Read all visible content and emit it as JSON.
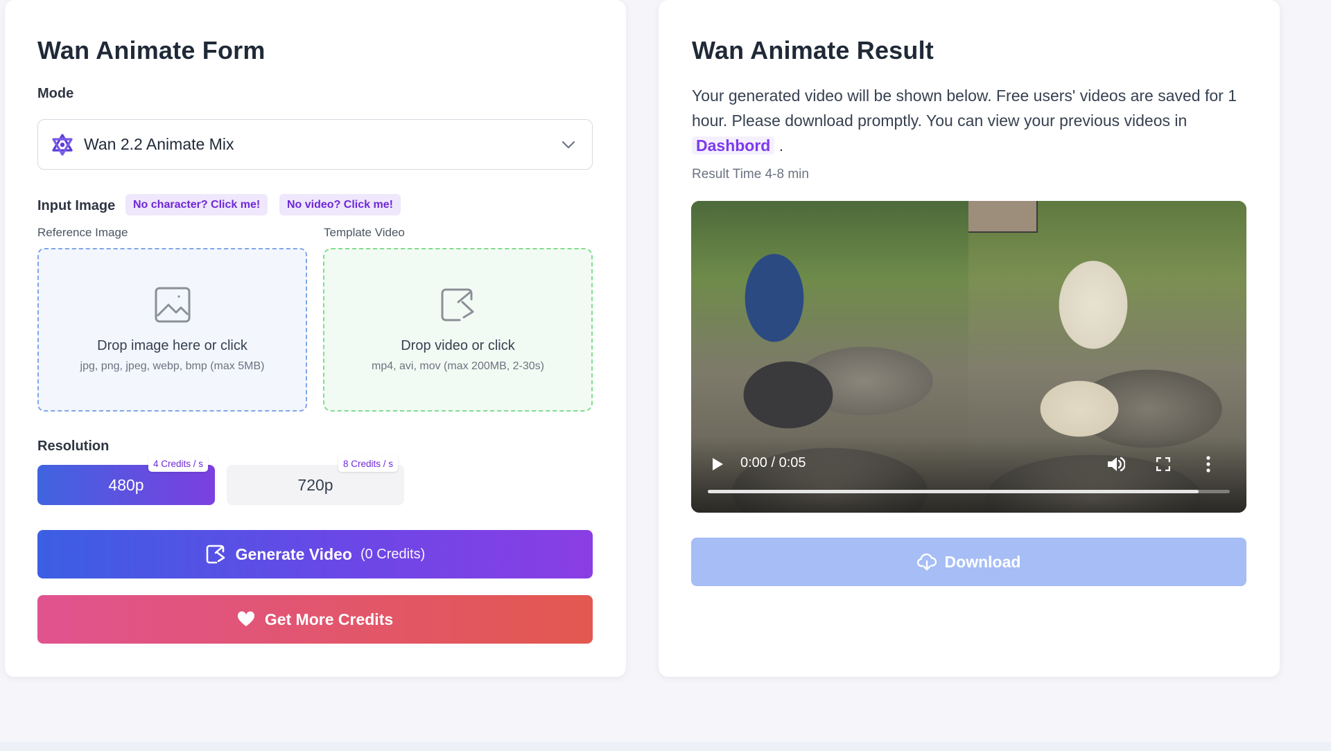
{
  "form": {
    "title": "Wan Animate Form",
    "mode_label": "Mode",
    "mode_value": "Wan 2.2 Animate Mix",
    "input_label": "Input Image",
    "pill_character": "No character? Click me!",
    "pill_video": "No video? Click me!",
    "reference_label": "Reference Image",
    "template_label": "Template Video",
    "image_drop": {
      "title": "Drop image here or click",
      "hint": "jpg, png, jpeg, webp, bmp (max 5MB)",
      "icon": "image-icon"
    },
    "video_drop": {
      "title": "Drop video or click",
      "hint": "mp4, avi, mov (max 200MB, 2-30s)",
      "icon": "video-upload-icon"
    },
    "resolution_label": "Resolution",
    "resolutions": [
      {
        "label": "480p",
        "credits": "4 Credits / s",
        "selected": true
      },
      {
        "label": "720p",
        "credits": "8 Credits / s",
        "selected": false
      }
    ],
    "generate_label": "Generate Video",
    "generate_credits": "(0 Credits)",
    "more_credits_label": "Get More Credits"
  },
  "result": {
    "title": "Wan Animate Result",
    "description": "Your generated video will be shown below. Free users' videos are saved for 1 hour. Please download promptly. You can view your previous videos in",
    "dashboard_link": "Dashbord",
    "description_end": ".",
    "result_time": "Result Time 4-8 min",
    "video": {
      "time": "0:00 / 0:05",
      "progress": 0.94
    },
    "download_label": "Download"
  },
  "colors": {
    "accent_purple": "#7c3aed",
    "gradient_start": "#3b5fe3",
    "gradient_end": "#8a3ee4",
    "credits_gradient_start": "#e0538f",
    "credits_gradient_end": "#e3584f",
    "download_disabled": "#a6bdf5"
  }
}
